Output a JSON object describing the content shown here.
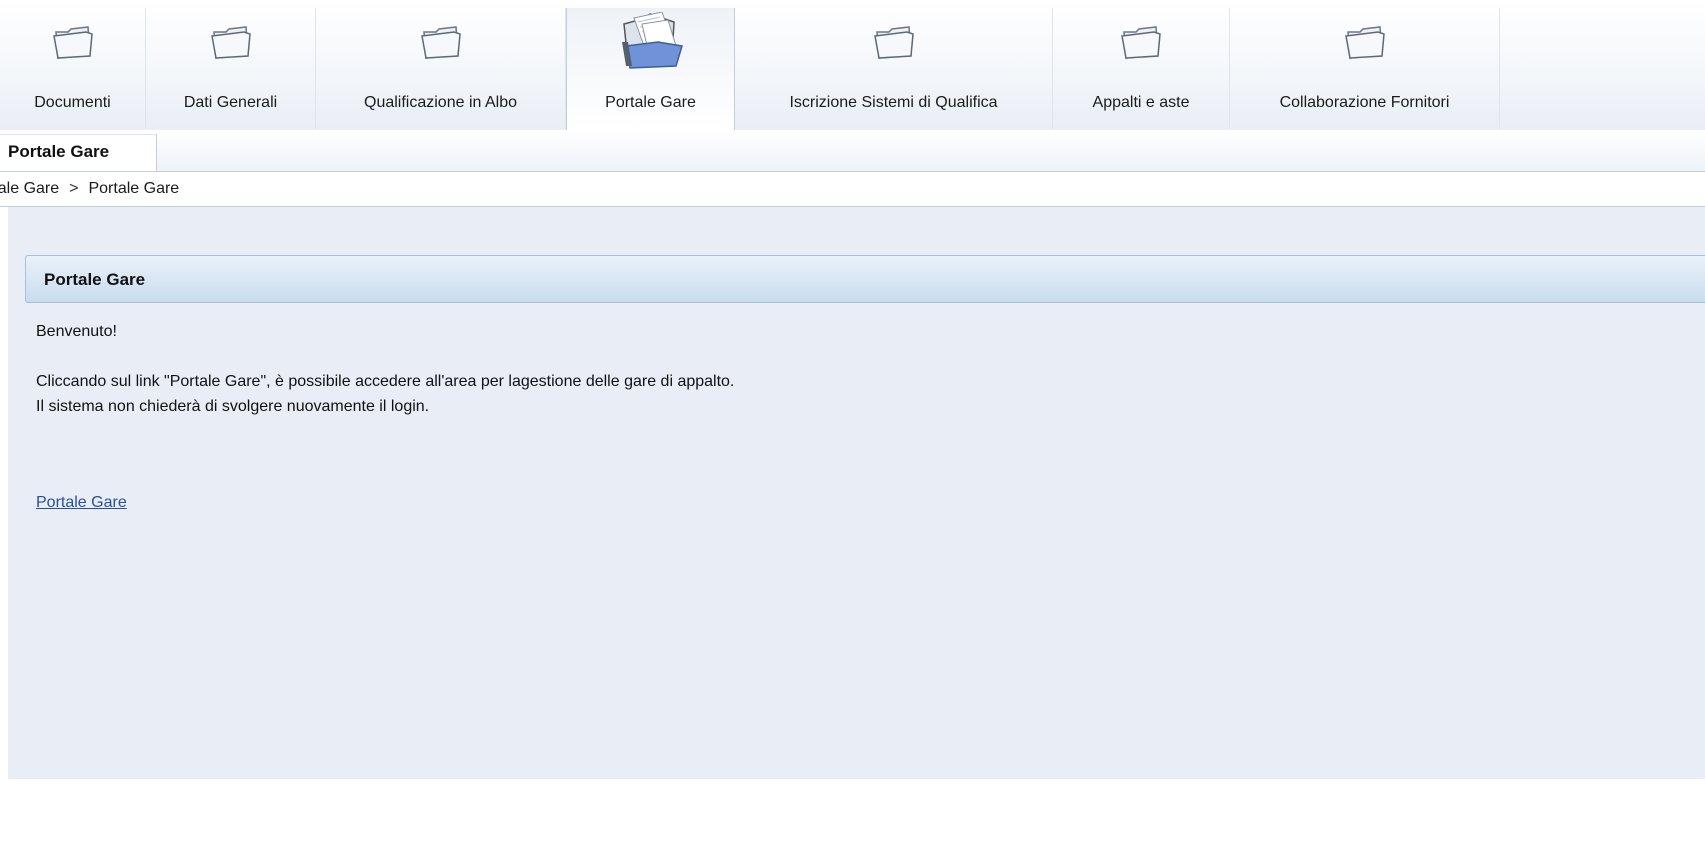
{
  "tabs": [
    {
      "label": "Documenti",
      "icon": "folder-icon"
    },
    {
      "label": "Dati Generali",
      "icon": "folder-icon"
    },
    {
      "label": "Qualificazione in Albo",
      "icon": "folder-icon"
    },
    {
      "label": "Portale Gare",
      "icon": "open-folder-documents-icon",
      "active": true
    },
    {
      "label": "Iscrizione Sistemi di Qualifica",
      "icon": "folder-icon"
    },
    {
      "label": "Appalti e aste",
      "icon": "folder-icon"
    },
    {
      "label": "Collaborazione Fornitori",
      "icon": "folder-icon"
    }
  ],
  "subnav": {
    "active_label": "Portale Gare"
  },
  "breadcrumb": {
    "parent": "rtale Gare",
    "separator": ">",
    "current": "Portale Gare"
  },
  "panel": {
    "title": "Portale Gare",
    "welcome": "Benvenuto!",
    "line1": "Cliccando sul link \"Portale Gare\", è possibile accedere all'area per lagestione delle gare di appalto.",
    "line2": "Il sistema non chiederà di svolgere nuovamente il login.",
    "link_label": "Portale Gare"
  },
  "colors": {
    "content_background": "#e9eef6",
    "panel_header_gradient_top": "#eaf1f9",
    "panel_header_gradient_bottom": "#c9dcef",
    "link": "#2a4f9a"
  }
}
